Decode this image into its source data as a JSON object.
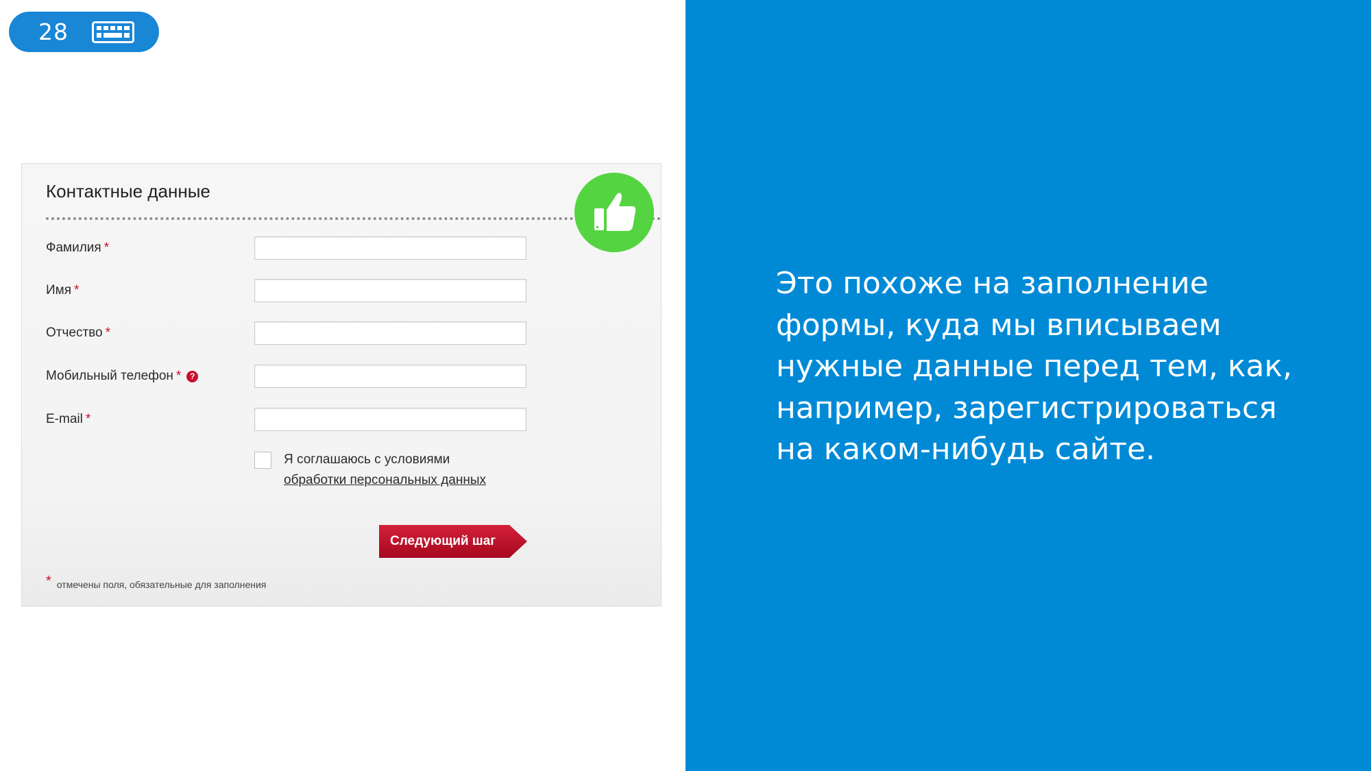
{
  "slide": {
    "number": "28",
    "icon": "keyboard-icon"
  },
  "colors": {
    "badge": "#1a86d6",
    "panel": "#008ad6",
    "thumb": "#55d441",
    "button": "#c8102e"
  },
  "form": {
    "title": "Контактные данные",
    "required_mark": "*",
    "fields": [
      {
        "label": "Фамилия",
        "value": ""
      },
      {
        "label": "Имя",
        "value": ""
      },
      {
        "label": "Отчество",
        "value": ""
      },
      {
        "label": "Мобильный телефон",
        "value": "",
        "help": "?"
      },
      {
        "label": "E-mail",
        "value": ""
      }
    ],
    "agree_text": "Я соглашаюсь с условиями",
    "agree_link": "обработки персональных данных",
    "agree_checked": false,
    "next_button": "Следующий шаг",
    "footnote": "отмечены поля, обязательные для заполнения",
    "thumb_icon": "thumbs-up-icon"
  },
  "panel": {
    "lines": [
      "Это похоже на заполнение",
      "формы, куда мы вписываем",
      "нужные данные перед тем, как,",
      "например, зарегистрироваться",
      "на каком-нибудь сайте."
    ]
  }
}
